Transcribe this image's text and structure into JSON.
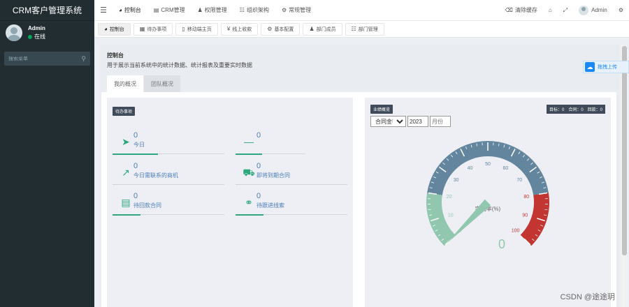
{
  "app": {
    "title": "CRM客户管理系统"
  },
  "user": {
    "name": "Admin",
    "status": "在线"
  },
  "sidebar": {
    "search_placeholder": "搜索菜单"
  },
  "topnav": {
    "items": [
      {
        "label": "控制台",
        "icon": "dashboard-icon"
      },
      {
        "label": "CRM管理",
        "icon": "list-icon"
      },
      {
        "label": "权限管理",
        "icon": "users-icon"
      },
      {
        "label": "组织架构",
        "icon": "sitemap-icon"
      },
      {
        "label": "常规管理",
        "icon": "cogs-icon"
      }
    ],
    "right": {
      "clear_cache": "清除缓存",
      "user": "Admin"
    }
  },
  "tabs": [
    {
      "label": "控制台"
    },
    {
      "label": "待办事项"
    },
    {
      "label": "移动端主页"
    },
    {
      "label": "线上收款"
    },
    {
      "label": "基本配置"
    },
    {
      "label": "部门成员"
    },
    {
      "label": "部门管理"
    }
  ],
  "page": {
    "title": "控制台",
    "description": "用于展示当前系统中的统计数据、统计报表及重要实时数据",
    "tabs": [
      "我的概况",
      "团队概况"
    ]
  },
  "upload": {
    "label": "拖拽上传"
  },
  "pending": {
    "badge": "待办事项",
    "stats": [
      {
        "value": "0",
        "label": "今日",
        "icon": "rocket-icon"
      },
      {
        "value": "0",
        "label": "",
        "icon": "minus-icon"
      },
      {
        "value": "0",
        "label": "今日需联系的商机",
        "icon": "line-chart-icon"
      },
      {
        "value": "0",
        "label": "即将到期合同",
        "icon": "truck-icon"
      },
      {
        "value": "0",
        "label": "待回款合同",
        "icon": "table-icon"
      },
      {
        "value": "0",
        "label": "待跟进线索",
        "icon": "link-icon"
      }
    ]
  },
  "performance": {
    "badge": "业绩概览",
    "counts": {
      "target": "目标：0",
      "contract": "合同：0",
      "payment": "回款：0"
    },
    "filter_metric": "合同金额",
    "filter_year": "2023",
    "filter_month_placeholder": "月份",
    "gauge": {
      "title": "完成率(%)",
      "value": 0,
      "value_label": "0",
      "ticks": [
        "0",
        "10",
        "20",
        "30",
        "40",
        "50",
        "60",
        "70",
        "80",
        "90",
        "100"
      ],
      "colors": {
        "low": "#91c7ae",
        "mid": "#63869e",
        "high": "#c23531"
      }
    }
  },
  "watermark": "CSDN @途途玥"
}
